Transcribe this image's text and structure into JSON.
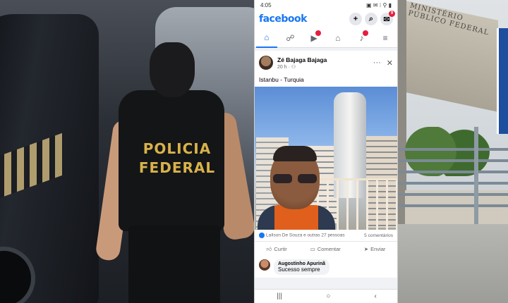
{
  "left_photo": {
    "vest_line1": "POLICIA",
    "vest_line2": "FEDERAL"
  },
  "phone": {
    "status_time": "4:05",
    "status_icons": "▣ ✉ ⁝ ⚲ ▮",
    "app_name": "facebook",
    "header_buttons": [
      "+",
      "⌕",
      "✉"
    ],
    "header_badge": "9",
    "nav_items": [
      {
        "name": "home",
        "icon": "⌂",
        "active": true
      },
      {
        "name": "friends",
        "icon": "☍"
      },
      {
        "name": "watch",
        "icon": "▶",
        "badge": true
      },
      {
        "name": "marketplace",
        "icon": "⌂"
      },
      {
        "name": "notifications",
        "icon": "♪",
        "badge": true
      },
      {
        "name": "menu",
        "icon": "≡"
      }
    ],
    "post": {
      "author": "Zé Bajaga Bajaga",
      "meta": "20 h · ⚇",
      "more": "···",
      "close": "✕",
      "text": "Istanbu - Turquia",
      "reactions_text": "Laílson De Souza e outras 27 pessoas",
      "comments_count": "5 comentários",
      "actions": {
        "like": "Curtir",
        "comment": "Comentar",
        "share": "Enviar"
      },
      "comment": {
        "name": "Augostinho Apurinã",
        "text": "Sucesso sempre"
      }
    },
    "android_nav": [
      "|||",
      "○",
      "‹"
    ]
  },
  "right_photo": {
    "facade_text": "MINISTÉRIO PÚBLICO FEDERAL"
  }
}
